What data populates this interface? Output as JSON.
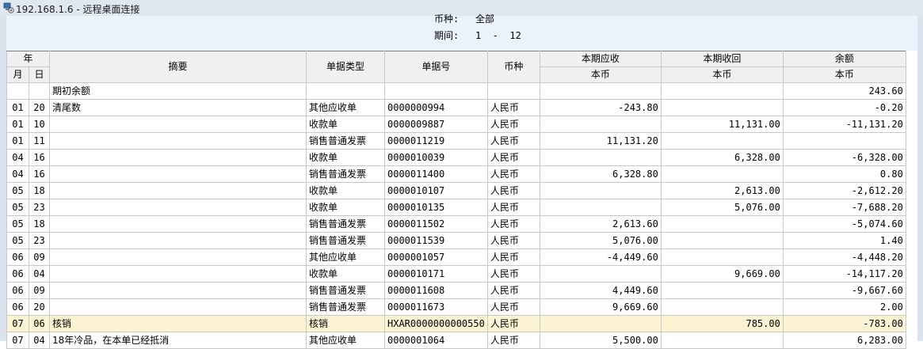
{
  "window": {
    "title": "192.168.1.6 - 远程桌面连接"
  },
  "report": {
    "currency_label": "币种:",
    "currency_value": "全部",
    "period_label": "期间:",
    "period_value": "1  -  12"
  },
  "columns": {
    "year": "年",
    "month": "月",
    "day": "日",
    "summary": "摘要",
    "doc_type": "单据类型",
    "doc_no": "单据号",
    "currency": "币种",
    "receivable": "本期应收",
    "received": "本期收回",
    "balance": "余额",
    "local_currency": "本币"
  },
  "rows": [
    {
      "m": "",
      "d": "",
      "summary": "期初余额",
      "type": "",
      "no": "",
      "cur": "",
      "rec": "",
      "got": "",
      "bal": "243.60"
    },
    {
      "m": "01",
      "d": "20",
      "summary": "清尾数",
      "type": "其他应收单",
      "no": "0000000994",
      "cur": "人民币",
      "rec": "-243.80",
      "got": "",
      "bal": "-0.20"
    },
    {
      "m": "01",
      "d": "10",
      "summary": "",
      "type": "收款单",
      "no": "0000009887",
      "cur": "人民币",
      "rec": "",
      "got": "11,131.00",
      "bal": "-11,131.20"
    },
    {
      "m": "01",
      "d": "11",
      "summary": "",
      "type": "销售普通发票",
      "no": "0000011219",
      "cur": "人民币",
      "rec": "11,131.20",
      "got": "",
      "bal": ""
    },
    {
      "m": "04",
      "d": "16",
      "summary": "",
      "type": "收款单",
      "no": "0000010039",
      "cur": "人民币",
      "rec": "",
      "got": "6,328.00",
      "bal": "-6,328.00"
    },
    {
      "m": "04",
      "d": "16",
      "summary": "",
      "type": "销售普通发票",
      "no": "0000011400",
      "cur": "人民币",
      "rec": "6,328.80",
      "got": "",
      "bal": "0.80"
    },
    {
      "m": "05",
      "d": "18",
      "summary": "",
      "type": "收款单",
      "no": "0000010107",
      "cur": "人民币",
      "rec": "",
      "got": "2,613.00",
      "bal": "-2,612.20"
    },
    {
      "m": "05",
      "d": "23",
      "summary": "",
      "type": "收款单",
      "no": "0000010135",
      "cur": "人民币",
      "rec": "",
      "got": "5,076.00",
      "bal": "-7,688.20"
    },
    {
      "m": "05",
      "d": "18",
      "summary": "",
      "type": "销售普通发票",
      "no": "0000011502",
      "cur": "人民币",
      "rec": "2,613.60",
      "got": "",
      "bal": "-5,074.60"
    },
    {
      "m": "05",
      "d": "23",
      "summary": "",
      "type": "销售普通发票",
      "no": "0000011539",
      "cur": "人民币",
      "rec": "5,076.00",
      "got": "",
      "bal": "1.40"
    },
    {
      "m": "06",
      "d": "09",
      "summary": "",
      "type": "其他应收单",
      "no": "0000001057",
      "cur": "人民币",
      "rec": "-4,449.60",
      "got": "",
      "bal": "-4,448.20"
    },
    {
      "m": "06",
      "d": "04",
      "summary": "",
      "type": "收款单",
      "no": "0000010171",
      "cur": "人民币",
      "rec": "",
      "got": "9,669.00",
      "bal": "-14,117.20"
    },
    {
      "m": "06",
      "d": "09",
      "summary": "",
      "type": "销售普通发票",
      "no": "0000011608",
      "cur": "人民币",
      "rec": "4,449.60",
      "got": "",
      "bal": "-9,667.60"
    },
    {
      "m": "06",
      "d": "20",
      "summary": "",
      "type": "销售普通发票",
      "no": "0000011673",
      "cur": "人民币",
      "rec": "9,669.60",
      "got": "",
      "bal": "2.00"
    },
    {
      "m": "07",
      "d": "06",
      "summary": "核销",
      "type": "核销",
      "no": "HXAR0000000000550",
      "cur": "人民币",
      "rec": "",
      "got": "785.00",
      "bal": "-783.00",
      "highlight": true
    },
    {
      "m": "07",
      "d": "04",
      "summary": "18年冷品，在本单已经抵消",
      "type": "其他应收单",
      "no": "0000001064",
      "cur": "人民币",
      "rec": "5,500.00",
      "got": "",
      "bal": "6,283.00"
    }
  ],
  "colors": {
    "highlight_row": "#fcf3d3",
    "header_bg": "#f0f0f0",
    "titlebar_bg": "#dfe7f1",
    "report_header_bg": "#eaf2fb"
  }
}
